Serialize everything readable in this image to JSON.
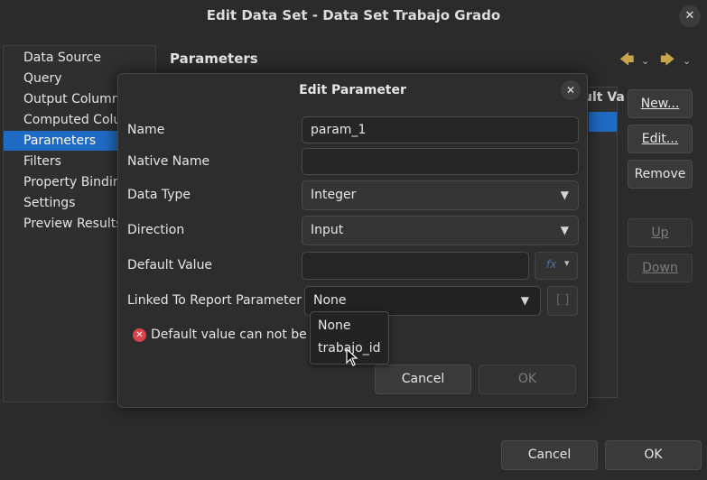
{
  "window": {
    "title": "Edit Data Set - Data Set Trabajo Grado",
    "close_icon": "close-icon"
  },
  "nav": {
    "items": [
      {
        "label": "Data Source"
      },
      {
        "label": "Query"
      },
      {
        "label": "Output Columns"
      },
      {
        "label": "Computed Columns"
      },
      {
        "label": "Parameters",
        "selected": true
      },
      {
        "label": "Filters"
      },
      {
        "label": "Property Binding"
      },
      {
        "label": "Settings"
      },
      {
        "label": "Preview Results"
      }
    ]
  },
  "panel": {
    "title": "Parameters",
    "grid_header": "ult Va",
    "history": {
      "back_icon": "arrow-left-icon",
      "forward_icon": "arrow-right-icon"
    }
  },
  "side_buttons": {
    "new": "New...",
    "edit": "Edit...",
    "remove": "Remove",
    "up": "Up",
    "down": "Down"
  },
  "footer": {
    "cancel": "Cancel",
    "ok": "OK"
  },
  "dialog": {
    "title": "Edit Parameter",
    "fields": {
      "name": {
        "label": "Name",
        "value": "param_1"
      },
      "native_name": {
        "label": "Native Name",
        "value": ""
      },
      "data_type": {
        "label": "Data Type",
        "value": "Integer"
      },
      "direction": {
        "label": "Direction",
        "value": "Input"
      },
      "default_value": {
        "label": "Default Value",
        "value": "",
        "expr_icon": "fx-icon"
      },
      "linked": {
        "label": "Linked To Report Parameter",
        "value": "None"
      }
    },
    "error": "Default value can not be no",
    "cancel": "Cancel",
    "ok": "OK"
  },
  "dropdown": {
    "options": [
      "None",
      "trabajo_id"
    ]
  },
  "colors": {
    "background": "#2b2b2b",
    "selection": "#1f6bc4",
    "error": "#d9434a",
    "history_arrow": "#c9a44c"
  }
}
